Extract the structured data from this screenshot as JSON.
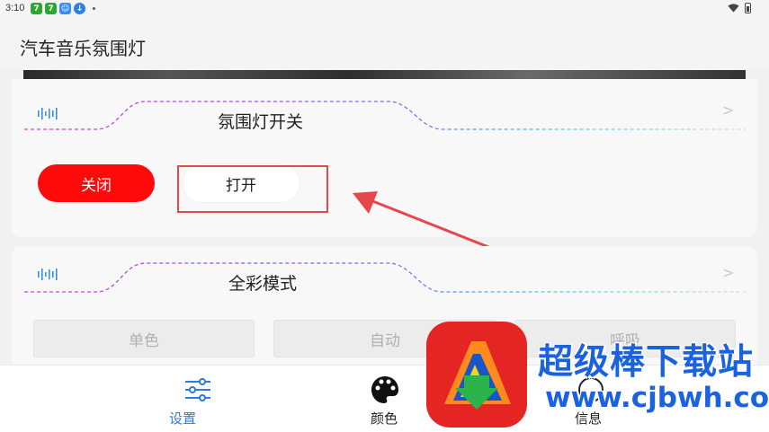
{
  "status_bar": {
    "time": "3:10",
    "notification_icons": [
      "green-app-icon",
      "green-app-icon",
      "blue-app-icon",
      "download-icon"
    ],
    "right_icons": [
      "wifi-icon",
      "battery-icon"
    ]
  },
  "app_bar": {
    "title": "汽车音乐氛围灯"
  },
  "switch_card": {
    "title": "氛围灯开关",
    "close_label": "关闭",
    "open_label": "打开",
    "chevron": ">"
  },
  "fullcolor_card": {
    "title": "全彩模式",
    "chevron": ">",
    "modes": [
      "单色",
      "自动",
      "呼吸"
    ]
  },
  "bottom_nav": {
    "items": [
      {
        "label": "设置",
        "icon": "sliders-icon",
        "active": true
      },
      {
        "label": "颜色",
        "icon": "palette-icon",
        "active": false
      },
      {
        "label": "信息",
        "icon": "info-icon",
        "active": false
      }
    ]
  },
  "watermark": {
    "brand": "超级棒下载站",
    "url": "www.cjbwh.com"
  },
  "colors": {
    "accent": "#2b7be0",
    "close_button": "#ff0a0a",
    "annotation": "#e6474a",
    "watermark_blue": "#1a62e0"
  }
}
